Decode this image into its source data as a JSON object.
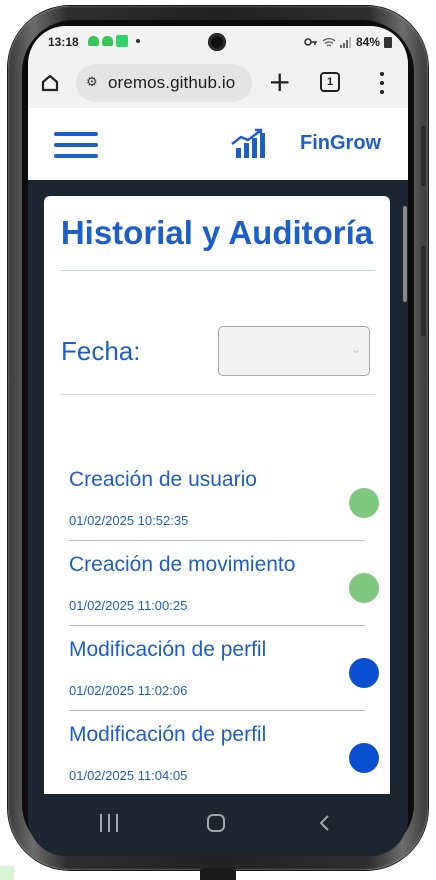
{
  "status_bar": {
    "time": "13:18",
    "battery": "84%"
  },
  "browser": {
    "url": "oremos.github.io",
    "tab_count": "1"
  },
  "app": {
    "brand": "FinGrow"
  },
  "page": {
    "title": "Historial y Auditoría",
    "filter_label": "Fecha:",
    "filter_value": ""
  },
  "events": [
    {
      "title": "Creación de usuario",
      "timestamp": "01/02/2025 10:52:35",
      "status_color": "#7ec97f"
    },
    {
      "title": "Creación de movimiento",
      "timestamp": "01/02/2025 11:00:25",
      "status_color": "#7ec97f"
    },
    {
      "title": "Modificación de perfil",
      "timestamp": "01/02/2025 11:02:06",
      "status_color": "#0a4fd1"
    },
    {
      "title": "Modificación de perfil",
      "timestamp": "01/02/2025 11:04:05",
      "status_color": "#0a4fd1"
    }
  ],
  "colors": {
    "accent": "#1d5fc8",
    "background_dark": "#1c2630"
  }
}
